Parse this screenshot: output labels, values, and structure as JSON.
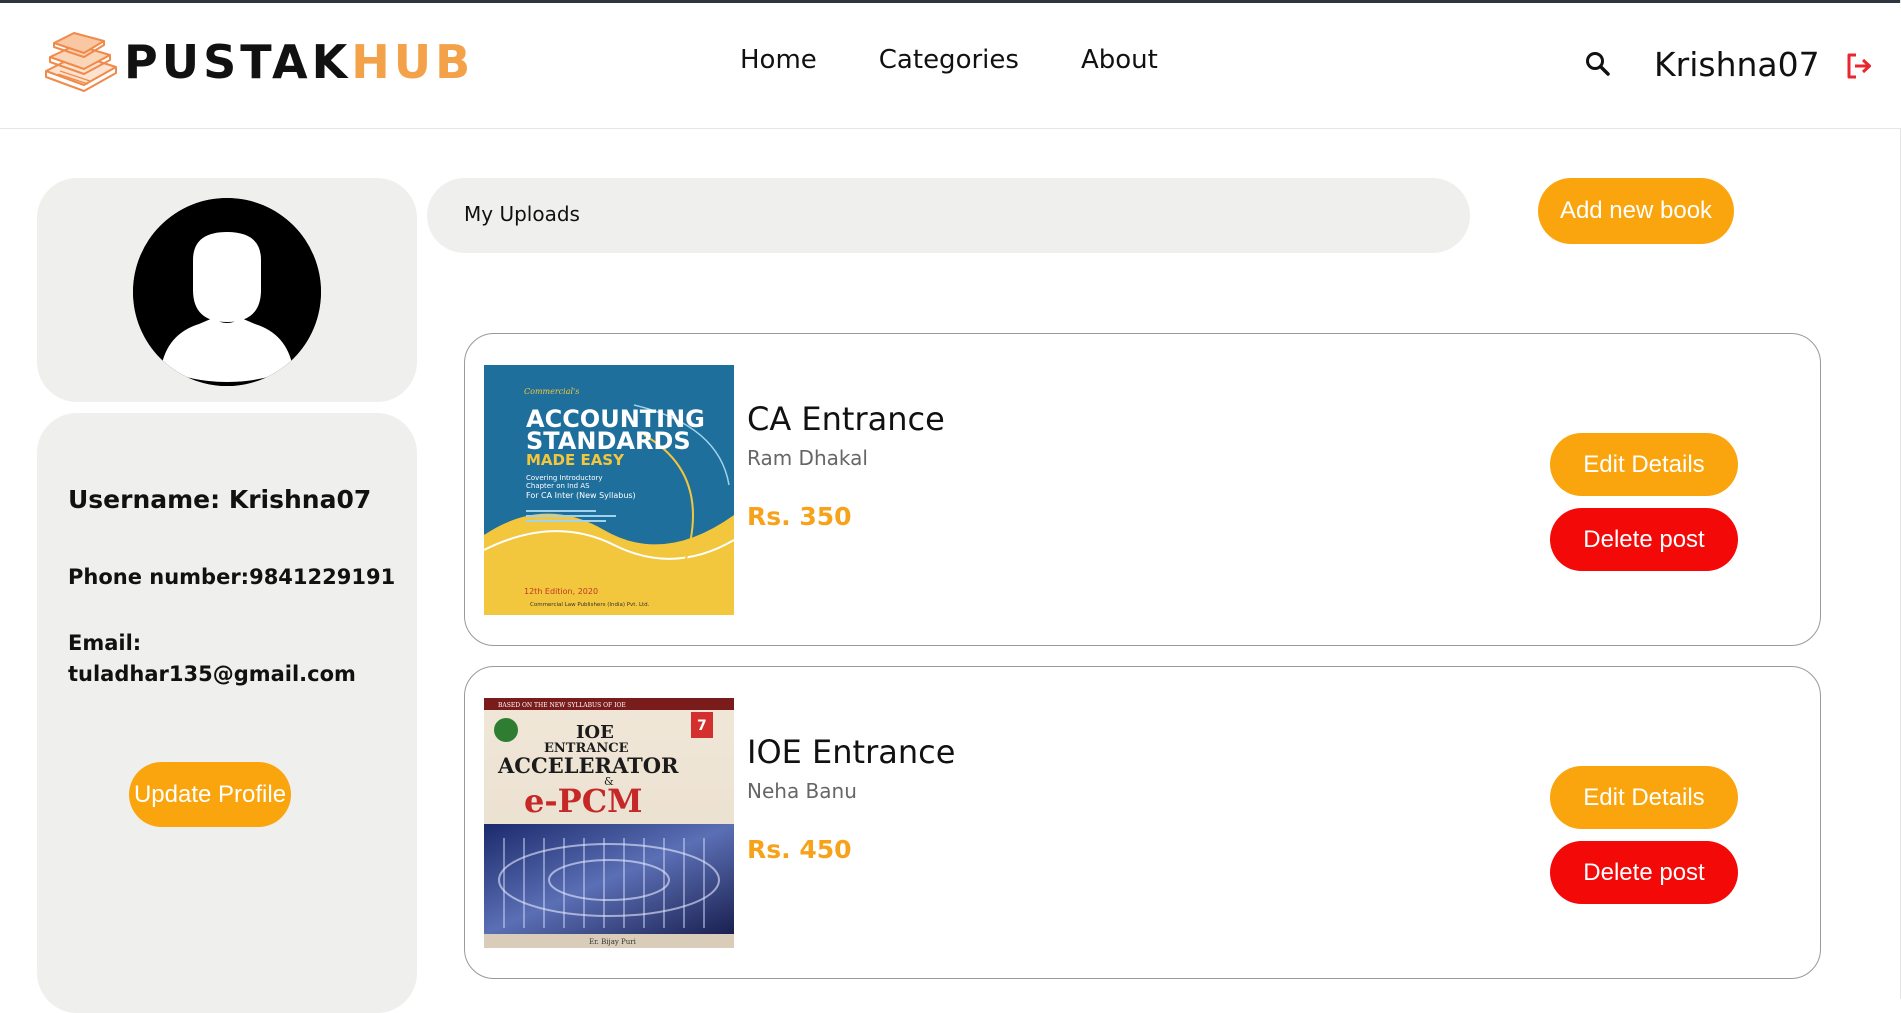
{
  "brand": {
    "name_dark": "PUSTAK",
    "name_accent": "HUB"
  },
  "nav": {
    "items": [
      "Home",
      "Categories",
      "About"
    ]
  },
  "header": {
    "username": "Krishna07"
  },
  "profile": {
    "username_text": "Username: Krishna07",
    "phone_text": "Phone number:9841229191",
    "email_label": "Email:",
    "email_value": "tuladhar135@gmail.com",
    "update_label": "Update Profile"
  },
  "uploads": {
    "label": "My Uploads",
    "add_label": "Add new book"
  },
  "books": [
    {
      "title": "CA Entrance",
      "author": "Ram Dhakal",
      "price": "Rs. 350",
      "edit_label": "Edit Details",
      "delete_label": "Delete post",
      "cover": {
        "publisher_tag": "Commercial's",
        "line1": "ACCOUNTING",
        "line2": "STANDARDS",
        "line3": "MADE EASY",
        "sub1": "Covering Introductory",
        "sub2": "Chapter on Ind AS",
        "sub3": "For CA Inter (New Syllabus)",
        "edition": "12th Edition, 2020",
        "publisher": "Commercial Law Publishers (India) Pvt. Ltd."
      }
    },
    {
      "title": "IOE Entrance",
      "author": "Neha Banu",
      "price": "Rs. 450",
      "edit_label": "Edit Details",
      "delete_label": "Delete post",
      "cover": {
        "top_tag": "BASED ON THE NEW SYLLABUS OF IOE",
        "line1": "IOE",
        "line2": "ENTRANCE",
        "line3": "ACCELERATOR",
        "amp": "&",
        "line4": "e-PCM",
        "author_tag": "Er. Bijay Puri",
        "badge": "7"
      }
    }
  ],
  "colors": {
    "accent_orange": "#faa50d",
    "danger_red": "#f40909",
    "panel_gray": "#efefed",
    "price_orange": "#f7a21b",
    "logo_orange": "#f4a24a"
  },
  "icons": {
    "search": "search-icon",
    "logout": "logout-icon",
    "logo": "books-logo-icon",
    "avatar": "user-avatar-icon"
  }
}
